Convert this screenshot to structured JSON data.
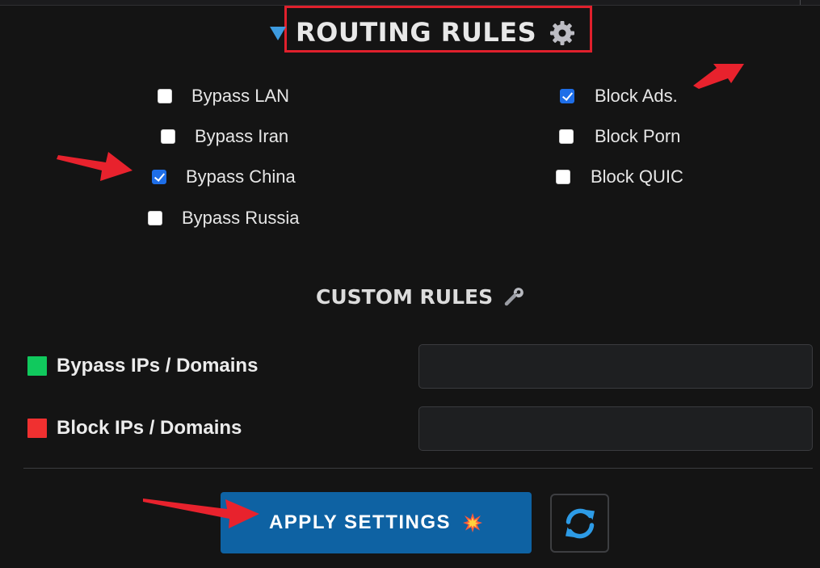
{
  "routing": {
    "title": "ROUTING RULES",
    "icons": {
      "collapse": "triangle-down-icon",
      "settings": "gear-icon"
    }
  },
  "options": {
    "bypass": [
      {
        "label": "Bypass LAN",
        "checked": false
      },
      {
        "label": "Bypass Iran",
        "checked": false
      },
      {
        "label": "Bypass China",
        "checked": true
      },
      {
        "label": "Bypass Russia",
        "checked": false
      }
    ],
    "block": [
      {
        "label": "Block Ads.",
        "checked": true
      },
      {
        "label": "Block Porn",
        "checked": false
      },
      {
        "label": "Block QUIC",
        "checked": false
      }
    ]
  },
  "custom": {
    "title": "CUSTOM RULES",
    "icon": "wrench-icon",
    "bypass_label": "Bypass IPs / Domains",
    "bypass_value": "",
    "block_label": "Block IPs / Domains",
    "block_value": ""
  },
  "actions": {
    "apply_label": "APPLY SETTINGS",
    "apply_icon": "collision-icon",
    "refresh_icon": "refresh-icon"
  },
  "colors": {
    "accent": "#0e62a3",
    "bypass_swatch": "#10c95d",
    "block_swatch": "#f03030",
    "highlight": "#e0202c",
    "background": "#141414"
  }
}
